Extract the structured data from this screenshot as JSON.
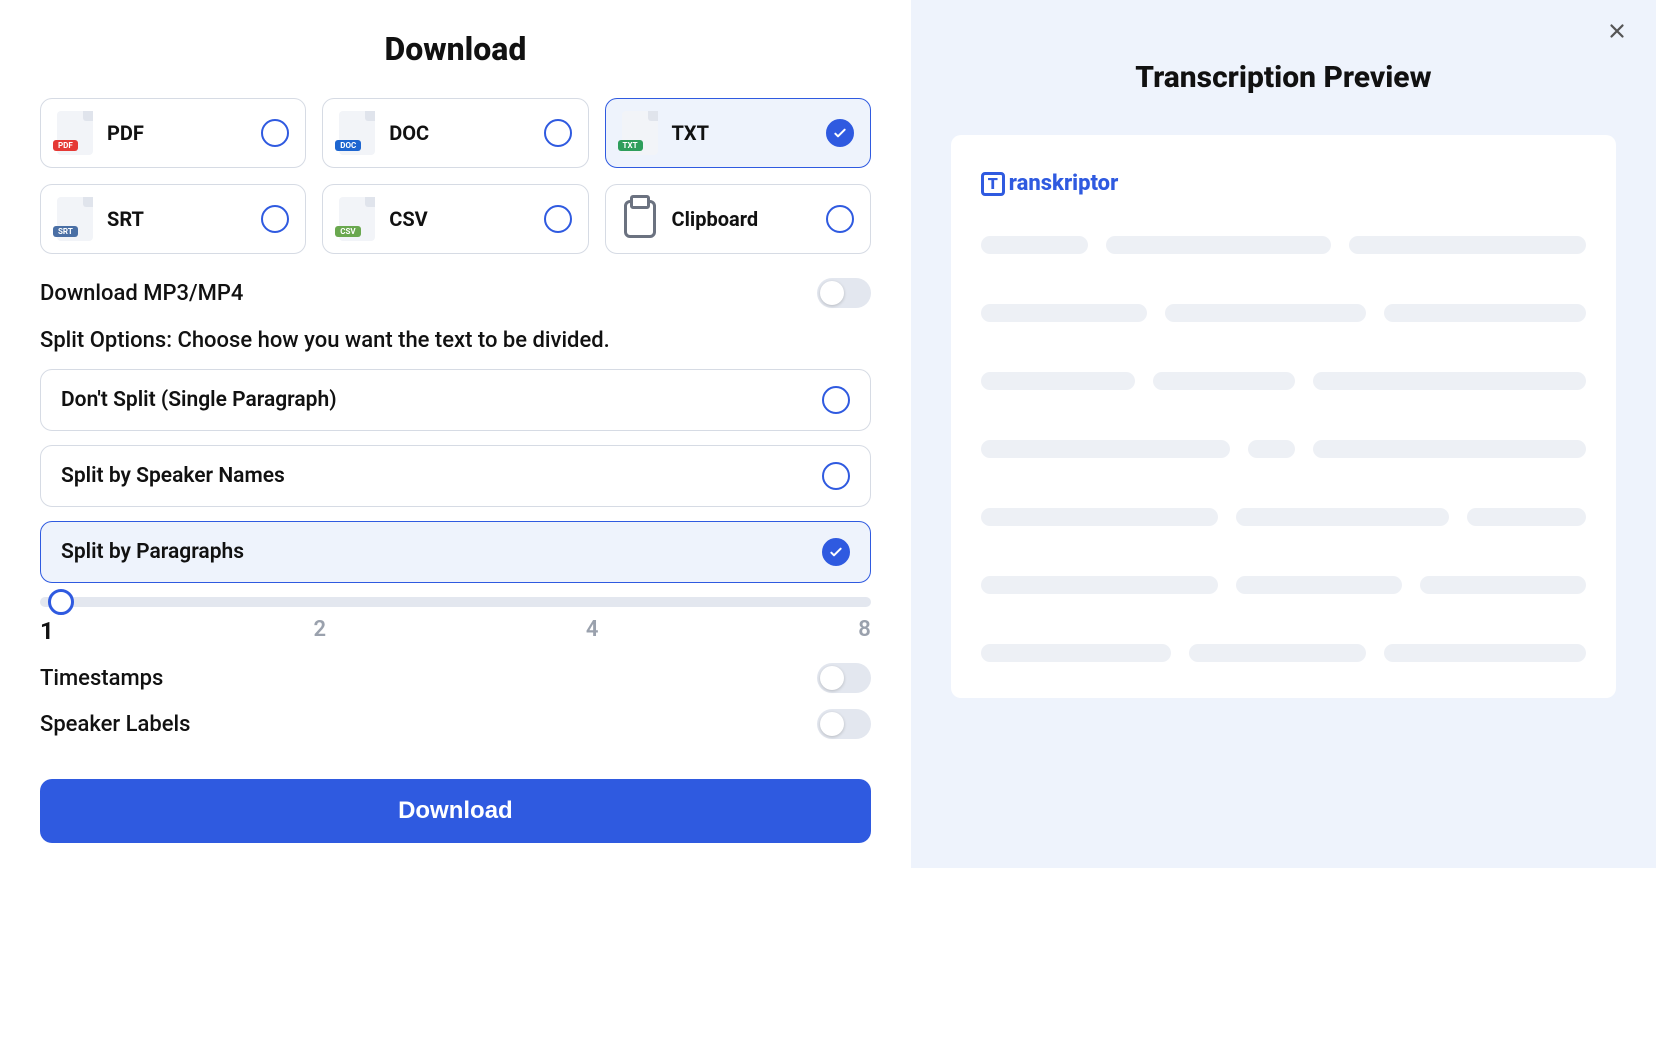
{
  "title": "Download",
  "formats": [
    {
      "label": "PDF",
      "badge": "PDF",
      "badgeClass": "badge-pdf",
      "selected": false
    },
    {
      "label": "DOC",
      "badge": "DOC",
      "badgeClass": "badge-doc",
      "selected": false
    },
    {
      "label": "TXT",
      "badge": "TXT",
      "badgeClass": "badge-txt",
      "selected": true
    },
    {
      "label": "SRT",
      "badge": "SRT",
      "badgeClass": "badge-srt",
      "selected": false
    },
    {
      "label": "CSV",
      "badge": "CSV",
      "badgeClass": "badge-csv",
      "selected": false
    },
    {
      "label": "Clipboard",
      "badge": null,
      "badgeClass": null,
      "selected": false
    }
  ],
  "download_media_label": "Download MP3/MP4",
  "download_media_on": false,
  "split_section_label": "Split Options: Choose how you want the text to be divided.",
  "split_options": [
    {
      "label": "Don't Split (Single Paragraph)",
      "selected": false
    },
    {
      "label": "Split by Speaker Names",
      "selected": false
    },
    {
      "label": "Split by Paragraphs",
      "selected": true
    }
  ],
  "slider": {
    "value": 1,
    "ticks": [
      "1",
      "2",
      "4",
      "8"
    ]
  },
  "timestamps_label": "Timestamps",
  "timestamps_on": false,
  "speaker_labels_label": "Speaker Labels",
  "speaker_labels_on": false,
  "download_button": "Download",
  "preview_title": "Transcription Preview",
  "brand": "ranskriptor",
  "brand_initial": "T"
}
